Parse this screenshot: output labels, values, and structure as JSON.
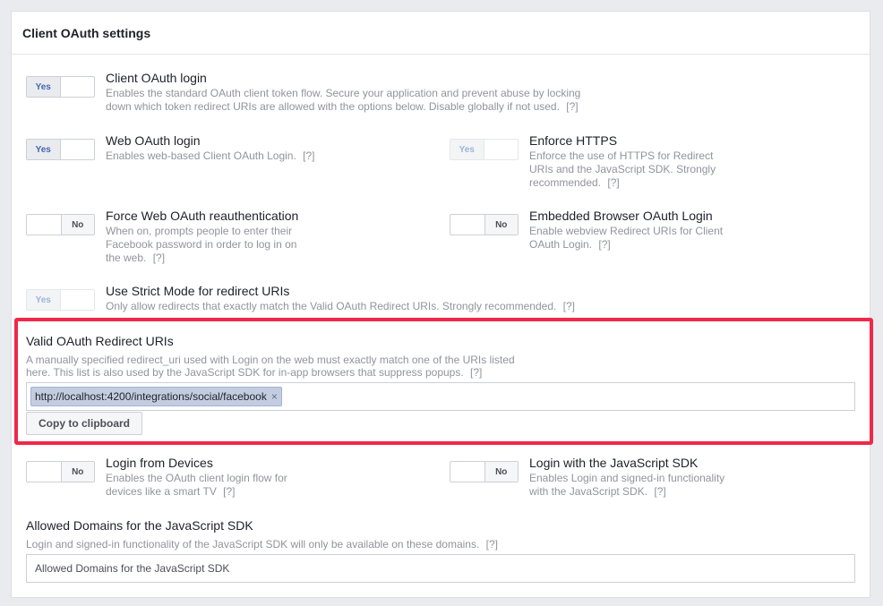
{
  "panel": {
    "title": "Client OAuth settings"
  },
  "help": "[?]",
  "settings": {
    "client_oauth": {
      "toggle": "Yes",
      "title": "Client OAuth login",
      "desc_l1": "Enables the standard OAuth client token flow. Secure your application and prevent abuse by locking",
      "desc_l2": "down which token redirect URIs are allowed with the options below. Disable globally if not used."
    },
    "web_oauth": {
      "toggle": "Yes",
      "title": "Web OAuth login",
      "desc_l1": "Enables web-based Client OAuth Login."
    },
    "enforce_https": {
      "toggle": "Yes",
      "title": "Enforce HTTPS",
      "desc_l1": "Enforce the use of HTTPS for Redirect",
      "desc_l2": "URIs and the JavaScript SDK. Strongly",
      "desc_l3": "recommended."
    },
    "force_reauth": {
      "toggle": "No",
      "title": "Force Web OAuth reauthentication",
      "desc_l1": "When on, prompts people to enter their",
      "desc_l2": "Facebook password in order to log in on",
      "desc_l3": "the web."
    },
    "embedded_browser": {
      "toggle": "No",
      "title": "Embedded Browser OAuth Login",
      "desc_l1": "Enable webview Redirect URIs for Client",
      "desc_l2": "OAuth Login."
    },
    "strict_mode": {
      "toggle": "Yes",
      "title": "Use Strict Mode for redirect URIs",
      "desc_l1": "Only allow redirects that exactly match the Valid OAuth Redirect URIs. Strongly recommended."
    },
    "login_devices": {
      "toggle": "No",
      "title": "Login from Devices",
      "desc_l1": "Enables the OAuth client login flow for",
      "desc_l2": "devices like a smart TV"
    },
    "js_sdk": {
      "toggle": "No",
      "title": "Login with the JavaScript SDK",
      "desc_l1": "Enables Login and signed-in functionality",
      "desc_l2": "with the JavaScript SDK."
    }
  },
  "redirect": {
    "label": "Valid OAuth Redirect URIs",
    "desc_l1": "A manually specified redirect_uri used with Login on the web must exactly match one of the URIs listed",
    "desc_l2": "here. This list is also used by the JavaScript SDK for in-app browsers that suppress popups.",
    "token": "http://localhost:4200/integrations/social/facebook",
    "remove": "×",
    "copy_label": "Copy to clipboard",
    "highlight_color": "#f02849"
  },
  "domains": {
    "label": "Allowed Domains for the JavaScript SDK",
    "desc": "Login and signed-in functionality of the JavaScript SDK will only be available on these domains.",
    "placeholder": "Allowed Domains for the JavaScript SDK"
  }
}
